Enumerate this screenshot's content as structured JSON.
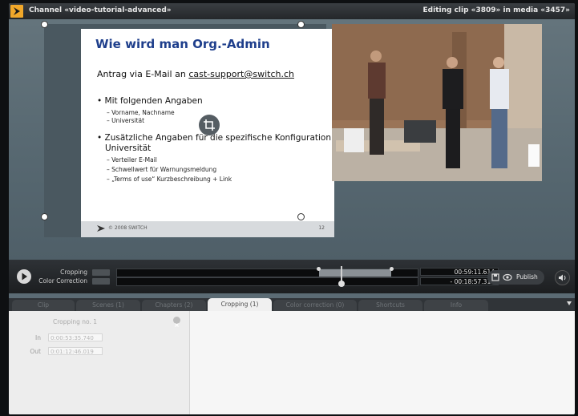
{
  "titlebar": {
    "channel": "Channel «video-tutorial-advanced»",
    "editing": "Editing clip «3809» in media «3457»"
  },
  "slide": {
    "heading": "Wie wird man Org.-Admin",
    "line1_prefix": "Antrag via E-Mail an ",
    "line1_link": "cast-support@switch.ch",
    "bullet1": "• Mit folgenden Angaben",
    "bullet1_sub": [
      "– Vorname, Nachname",
      "– Universität"
    ],
    "bullet2": "• Zusätzliche Angaben für die spezifische Konfiguration der",
    "bullet2_cont": "Universität",
    "bullet2_sub": [
      "– Verteiler E-Mail",
      "– Schwellwert für Warnungsmeldung",
      "– „Terms of use“ Kurzbeschreibung + Link"
    ],
    "footer_logo": "© 2008 SWITCH",
    "footer_page": "12"
  },
  "controls": {
    "cropping_label": "Cropping",
    "color_correction_label": "Color Correction",
    "time_top": "00:59:11.614",
    "time_bottom": "- 00:18:57.314",
    "publish_label": "Publish",
    "progress_fraction": 0.75
  },
  "tabs": [
    {
      "label": "Clip",
      "active": false
    },
    {
      "label": "Scenes (1)",
      "active": false
    },
    {
      "label": "Chapters (2)",
      "active": false
    },
    {
      "label": "Cropping (1)",
      "active": true
    },
    {
      "label": "Color correction (0)",
      "active": false
    },
    {
      "label": "Shortcuts",
      "active": false
    },
    {
      "label": "Info",
      "active": false
    }
  ],
  "panel": {
    "title": "Cropping no. 1",
    "in_label": "In",
    "in_value": "0:00:53:35.740",
    "out_label": "Out",
    "out_value": "0:01:12:46.019"
  },
  "colors": {
    "accent": "#f1a82a",
    "slide_heading": "#1f3f8c"
  }
}
